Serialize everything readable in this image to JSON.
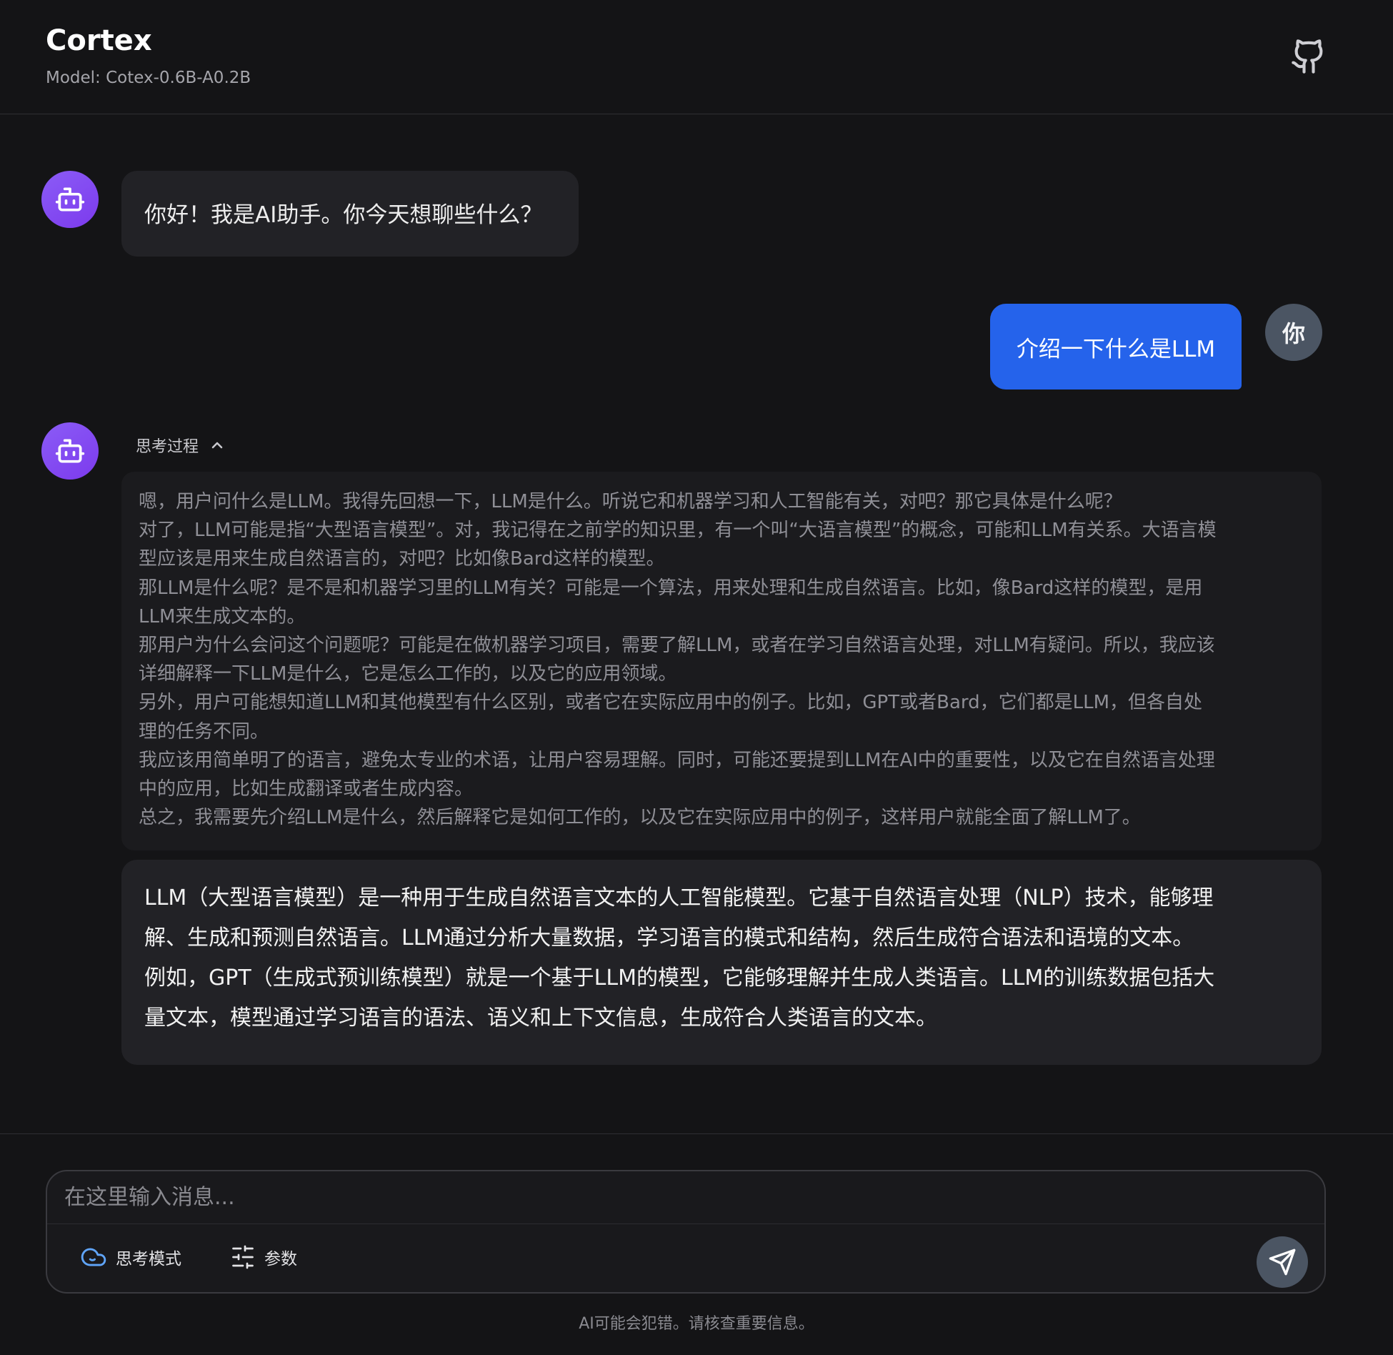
{
  "header": {
    "title": "Cortex",
    "model_label": "Model: Cotex-0.6B-A0.2B",
    "github_icon": "github-icon"
  },
  "messages": {
    "bot_greeting": "你好！我是AI助手。你今天想聊些什么？",
    "user_message": "介绍一下什么是LLM",
    "user_avatar_label": "你",
    "thinking_label": "思考过程",
    "thinking_lines": [
      "嗯，用户问什么是LLM。我得先回想一下，LLM是什么。听说它和机器学习和人工智能有关，对吧？那它具体是什么呢？",
      "对了，LLM可能是指“大型语言模型”。对，我记得在之前学的知识里，有一个叫“大语言模型”的概念，可能和LLM有关系。大语言模",
      "型应该是用来生成自然语言的，对吧？比如像Bard这样的模型。",
      "那LLM是什么呢？是不是和机器学习里的LLM有关？可能是一个算法，用来处理和生成自然语言。比如，像Bard这样的模型，是用",
      "LLM来生成文本的。",
      "那用户为什么会问这个问题呢？可能是在做机器学习项目，需要了解LLM，或者在学习自然语言处理，对LLM有疑问。所以，我应该",
      "详细解释一下LLM是什么，它是怎么工作的，以及它的应用领域。",
      "另外，用户可能想知道LLM和其他模型有什么区别，或者它在实际应用中的例子。比如，GPT或者Bard，它们都是LLM，但各自处",
      "理的任务不同。",
      "我应该用简单明了的语言，避免太专业的术语，让用户容易理解。同时，可能还要提到LLM在AI中的重要性，以及它在自然语言处理",
      "中的应用，比如生成翻译或者生成内容。",
      "总之，我需要先介绍LLM是什么，然后解释它是如何工作的，以及它在实际应用中的例子，这样用户就能全面了解LLM了。"
    ],
    "answer_lines": [
      "LLM（大型语言模型）是一种用于生成自然语言文本的人工智能模型。它基于自然语言处理（NLP）技术，能够理",
      "解、生成和预测自然语言。LLM通过分析大量数据，学习语言的模式和结构，然后生成符合语法和语境的文本。",
      "例如，GPT（生成式预训练模型）就是一个基于LLM的模型，它能够理解并生成人类语言。LLM的训练数据包括大",
      "量文本，模型通过学习语言的语法、语义和上下文信息，生成符合人类语言的文本。"
    ]
  },
  "composer": {
    "placeholder": "在这里输入消息...",
    "think_mode_label": "思考模式",
    "params_label": "参数",
    "think_icon": "cloud-icon",
    "params_icon": "sliders-icon",
    "send_icon": "send-icon"
  },
  "disclaimer": "AI可能会犯错。请核查重要信息。",
  "colors": {
    "background": "#141416",
    "bot_avatar": "#8b5cf6",
    "user_bubble": "#2563eb",
    "user_avatar": "#4b5563",
    "think_icon": "#60a5fa"
  }
}
